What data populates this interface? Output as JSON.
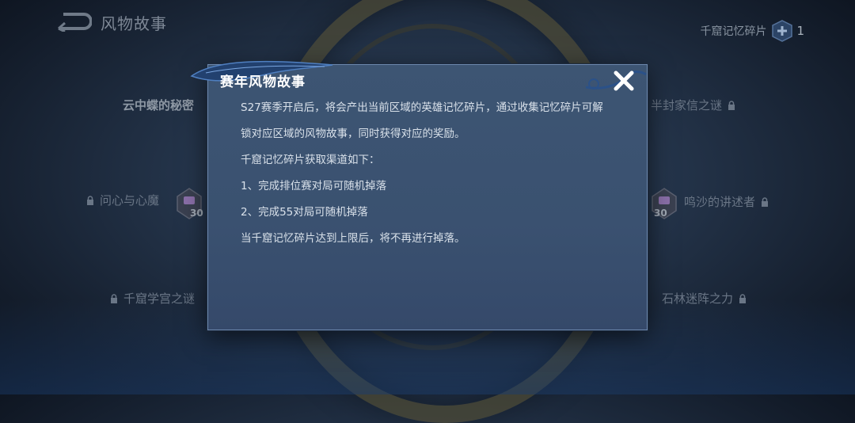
{
  "header": {
    "title": "风物故事",
    "currency_label": "千窟记忆碎片",
    "currency_count": "1"
  },
  "map_nodes": {
    "cloud_butterfly": "云中蝶的秘密",
    "half_sealed": "半封家信之谜",
    "heart_demon": "问心与心魔",
    "sand_narrator": "鸣沙的讲述者",
    "cave_scholar": "千窟学宫之谜",
    "stone_forest": "石林迷阵之力",
    "badge_left": "30",
    "badge_right": "30"
  },
  "dialog": {
    "title": "赛年风物故事",
    "lines": [
      "S27赛季开启后，将会产出当前区域的英雄记忆碎片，通过收集记忆碎片可解",
      "锁对应区域的风物故事，同时获得对应的奖励。",
      "千窟记忆碎片获取渠道如下：",
      "1、完成排位赛对局可随机掉落",
      "2、完成55对局可随机掉落",
      "当千窟记忆碎片达到上限后，将不再进行掉落。"
    ]
  },
  "colors": {
    "dialog_bg": "#3b5370",
    "dialog_border": "#6d88ad",
    "title_text": "#ffffff",
    "body_text": "#d9e1ea"
  },
  "icons": [
    "back-arrow-icon",
    "shard-icon",
    "plus-icon",
    "lock-icon",
    "close-icon",
    "chest-icon"
  ]
}
